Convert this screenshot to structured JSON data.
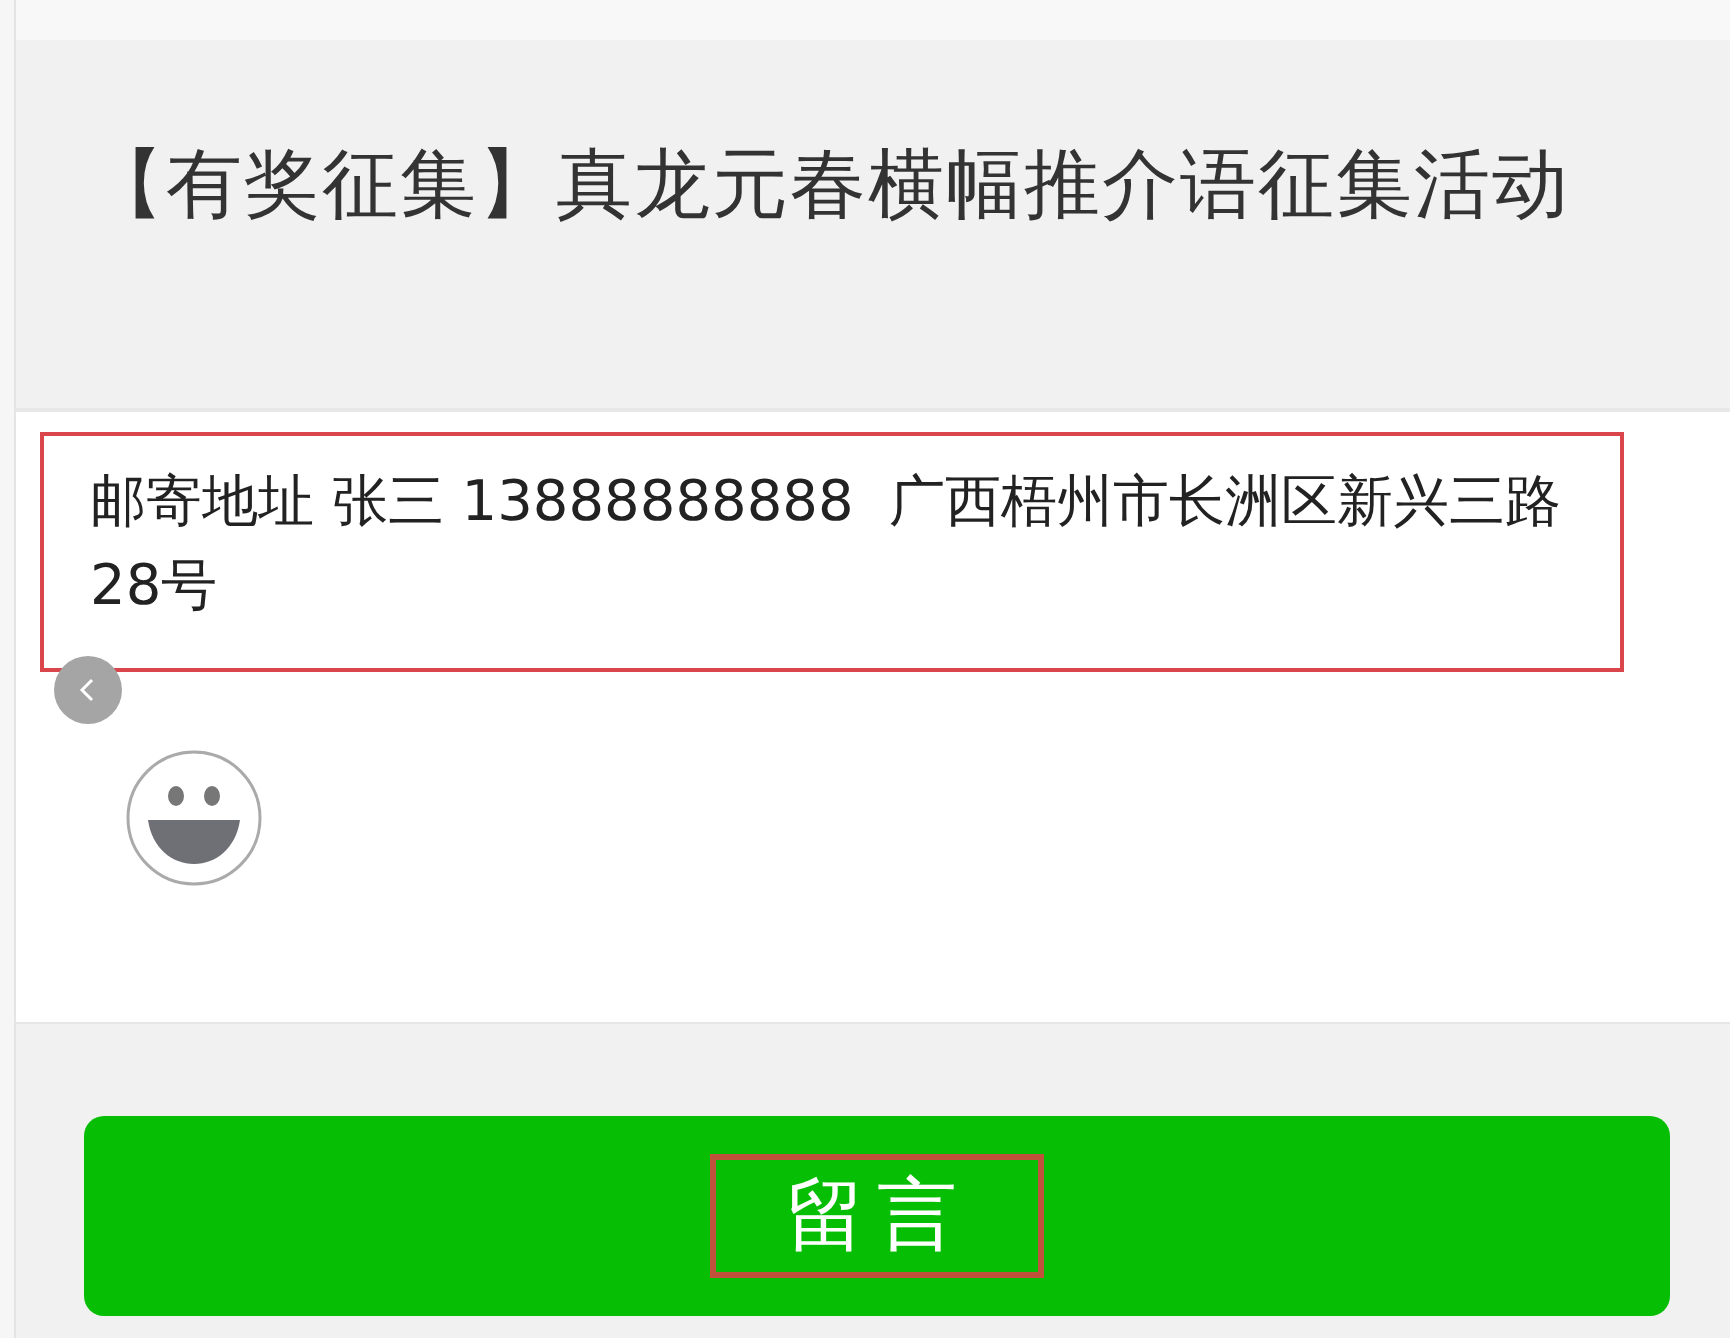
{
  "article_title": "【有奖征集】真龙元春横幅推介语征集活动",
  "comment": {
    "value": "邮寄地址 张三 13888888888  广西梧州市长洲区新兴三路28号",
    "highlighted": true
  },
  "submit_button": {
    "label": "留言",
    "highlighted": true
  }
}
